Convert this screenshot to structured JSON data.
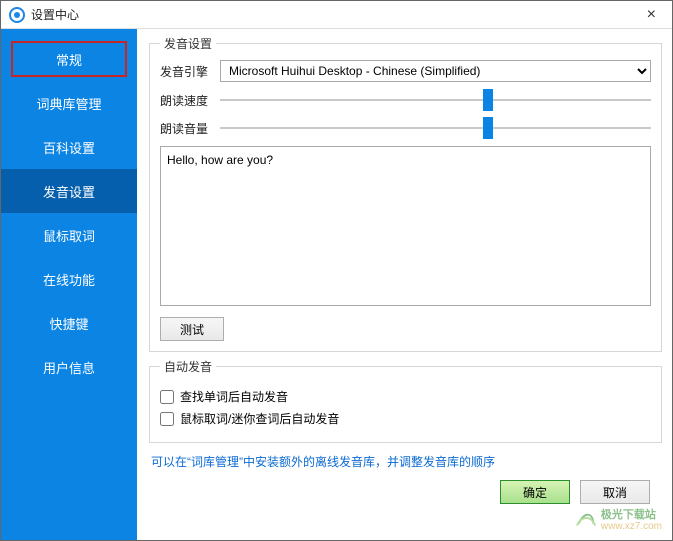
{
  "title": "设置中心",
  "sidebar": {
    "items": [
      {
        "label": "常规"
      },
      {
        "label": "词典库管理"
      },
      {
        "label": "百科设置"
      },
      {
        "label": "发音设置"
      },
      {
        "label": "鼠标取词"
      },
      {
        "label": "在线功能"
      },
      {
        "label": "快捷键"
      },
      {
        "label": "用户信息"
      }
    ]
  },
  "pronounce": {
    "legend": "发音设置",
    "engine_label": "发音引擎",
    "engine_value": "Microsoft Huihui Desktop - Chinese (Simplified)",
    "speed_label": "朗读速度",
    "volume_label": "朗读音量",
    "sample_text": "Hello, how are you?",
    "test_label": "测试"
  },
  "auto": {
    "legend": "自动发音",
    "chk1": "查找单词后自动发音",
    "chk2": "鼠标取词/迷你查词后自动发音"
  },
  "hint": "可以在“词库管理”中安装额外的离线发音库，并调整发音库的顺序",
  "footer": {
    "ok": "确定",
    "cancel": "取消"
  },
  "watermark": {
    "cn": "极光下载站",
    "url": "www.xz7.com"
  },
  "colors": {
    "sidebar_bg": "#0b84e4",
    "sidebar_active": "#055fad",
    "highlight_border": "#c62626",
    "link": "#0b6ad4"
  }
}
